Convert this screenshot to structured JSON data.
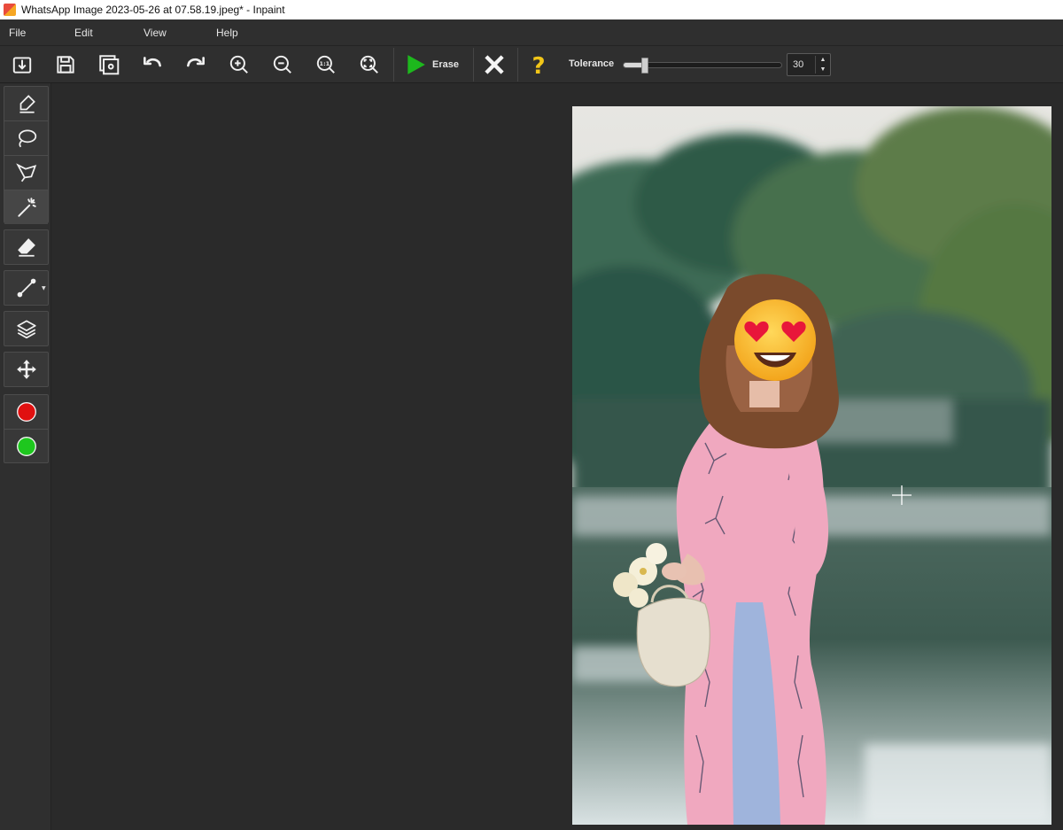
{
  "window": {
    "title": "WhatsApp Image 2023-05-26 at 07.58.19.jpeg* - Inpaint"
  },
  "menu": {
    "file": "File",
    "edit": "Edit",
    "view": "View",
    "help": "Help"
  },
  "toolbar": {
    "erase_label": "Erase",
    "tolerance_label": "Tolerance",
    "tolerance_value": "30",
    "tolerance_fraction": 0.14,
    "icons": [
      "open-icon",
      "save-icon",
      "save-as-icon",
      "undo-icon",
      "redo-icon",
      "zoom-in-icon",
      "zoom-out-icon",
      "zoom-actual-icon",
      "zoom-fit-icon",
      "play-icon",
      "close-icon",
      "help-icon"
    ]
  },
  "sidebar": {
    "tools": [
      "marker-icon",
      "lasso-icon",
      "polygonal-lasso-icon",
      "magic-wand-icon",
      "eraser-icon",
      "line-icon",
      "layers-icon",
      "move-icon",
      "red-color-icon",
      "green-color-icon"
    ],
    "active_tool": "magic-wand-icon"
  },
  "colors": {
    "erase_green": "#1db81d",
    "help_yellow": "#f2c618",
    "marker_red": "#e01010",
    "marker_green": "#1ec71e"
  }
}
